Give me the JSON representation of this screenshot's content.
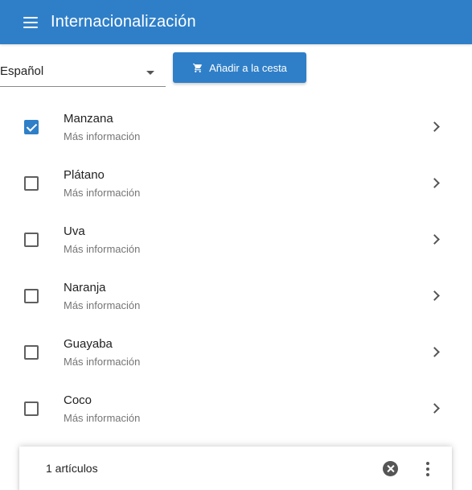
{
  "app_bar": {
    "title": "Internacionalización",
    "menu_icon": "menu-icon",
    "color": "#2f7fc8"
  },
  "toolbar": {
    "language_select": {
      "value": "Español"
    },
    "cart_button": {
      "label": "Añadir a la cesta",
      "icon": "cart-icon"
    }
  },
  "list": {
    "items": [
      {
        "title": "Manzana",
        "subtitle": "Más información",
        "checked": true
      },
      {
        "title": "Plátano",
        "subtitle": "Más información",
        "checked": false
      },
      {
        "title": "Uva",
        "subtitle": "Más información",
        "checked": false
      },
      {
        "title": "Naranja",
        "subtitle": "Más información",
        "checked": false
      },
      {
        "title": "Guayaba",
        "subtitle": "Más información",
        "checked": false
      },
      {
        "title": "Coco",
        "subtitle": "Más información",
        "checked": false
      }
    ]
  },
  "selection_bar": {
    "text": "1 artículos",
    "clear_icon": "clear-icon",
    "more_icon": "more-vert-icon"
  }
}
